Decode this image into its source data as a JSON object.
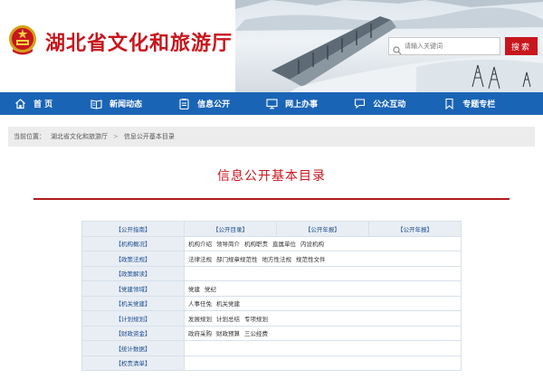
{
  "header": {
    "site_title": "湖北省文化和旅游厅",
    "search_placeholder": "请输入关键词",
    "search_button": "搜索"
  },
  "nav": {
    "items": [
      {
        "label": "首  页",
        "icon": "home-icon"
      },
      {
        "label": "新闻动态",
        "icon": "book-icon"
      },
      {
        "label": "信息公开",
        "icon": "clipboard-icon"
      },
      {
        "label": "网上办事",
        "icon": "monitor-icon"
      },
      {
        "label": "公众互动",
        "icon": "chat-icon"
      },
      {
        "label": "专题专栏",
        "icon": "bookmark-icon"
      }
    ]
  },
  "breadcrumb": {
    "prefix": "当前位置：",
    "items": [
      "湖北省文化和旅游厅",
      "信息公开基本目录"
    ],
    "separator": ">"
  },
  "main": {
    "title": "信息公开基本目录"
  },
  "table": {
    "header_row": [
      "【公开指南】",
      "【公开目录】",
      "【公开年报】",
      "【公开年报】"
    ],
    "rows": [
      {
        "label": "【机构概况】",
        "links": [
          "机构介绍",
          "领导简介",
          "机构职责",
          "直属单位",
          "内设机构"
        ]
      },
      {
        "label": "【政策法规】",
        "links": [
          "法律法规",
          "部门规章规范性",
          "地方性法规",
          "规范性文件"
        ]
      },
      {
        "label": "【政策解读】",
        "links": []
      },
      {
        "label": "【党建领域】",
        "links": [
          "党建",
          "党纪"
        ]
      },
      {
        "label": "【机关党建】",
        "links": [
          "人事任免",
          "机关党建"
        ]
      },
      {
        "label": "【计划规划】",
        "links": [
          "发展规划",
          "计划总结",
          "专项规划"
        ]
      },
      {
        "label": "【财政资金】",
        "links": [
          "政府采购",
          "财政预算",
          "三公经费"
        ]
      },
      {
        "label": "【统计数据】",
        "links": []
      },
      {
        "label": "【权责清单】",
        "links": []
      }
    ]
  },
  "colors": {
    "brand_red": "#c8161d",
    "nav_blue": "#1a64b6",
    "table_label_bg": "#e9eef5"
  }
}
